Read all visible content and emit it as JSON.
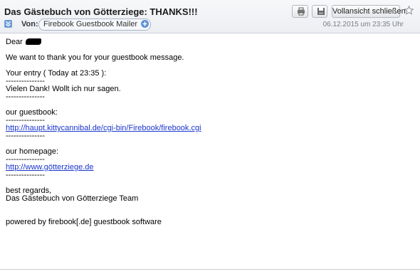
{
  "header": {
    "subject": "Das Gästebuch von Götterziege: THANKS!!!",
    "close_full_view_label": "Vollansicht schließen",
    "from_label": "Von:",
    "sender": "Firebook Guestbook Mailer",
    "date": "06.12.2015 um 23:35 Uhr",
    "icons": [
      "print-icon",
      "save-icon",
      "star-icon",
      "collapse-icon",
      "add-contact-icon"
    ]
  },
  "message": {
    "greeting": "Dear",
    "thanks": "We want to thank you for your guestbook message.",
    "entry_label": "Your entry ( Today at 23:35 ):",
    "separator": "---------------",
    "entry_text": "Vielen Dank! Wollt ich nur sagen.",
    "guestbook_label": "our guestbook:",
    "guestbook_url": "http://haupt.kittycannibal.de/cgi-bin/Firebook/firebook.cgi",
    "homepage_label": "our homepage:",
    "homepage_url": "http://www.götterziege.de",
    "regards": "best regards,",
    "team": "Das Gästebuch von Götterziege Team",
    "powered_by": "powered by firebook[.de] guestbook software"
  }
}
